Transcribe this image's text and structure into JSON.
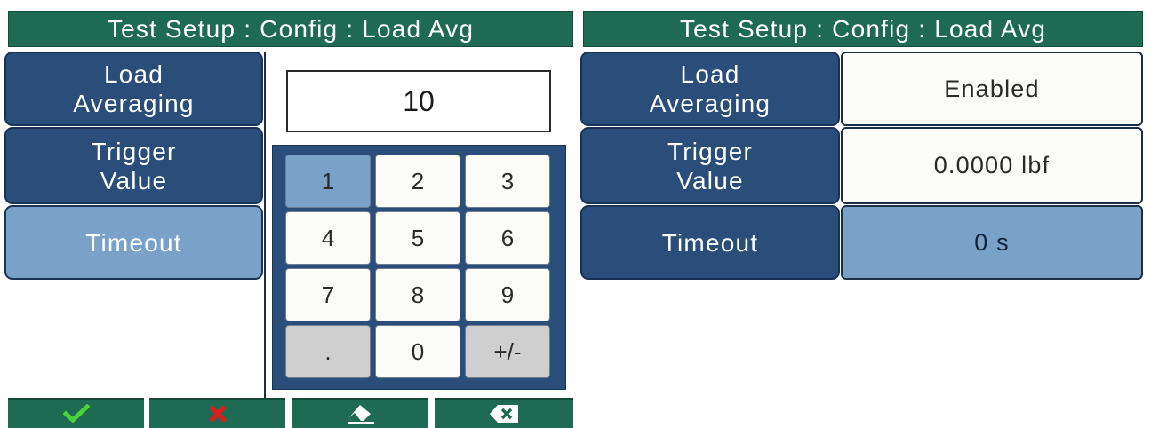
{
  "left_screen": {
    "title": "Test Setup : Config : Load Avg",
    "labels": [
      "Load\nAveraging",
      "Trigger\nValue",
      "Timeout"
    ],
    "entry_value": "10",
    "keypad": [
      [
        "1",
        "2",
        "3"
      ],
      [
        "4",
        "5",
        "6"
      ],
      [
        "7",
        "8",
        "9"
      ],
      [
        ".",
        "0",
        "+/-"
      ]
    ],
    "selected_key": "1",
    "footer": {
      "confirm_icon": "check-icon",
      "cancel_icon": "x-icon",
      "clear_icon": "eraser-icon",
      "backspace_icon": "backspace-icon"
    }
  },
  "right_screen": {
    "title": "Test Setup : Config : Load Avg",
    "rows": [
      {
        "label": "Load\nAveraging",
        "value": "Enabled"
      },
      {
        "label": "Trigger\nValue",
        "value": "0.0000 lbf"
      },
      {
        "label": "Timeout",
        "value": "0 s"
      }
    ],
    "active_row": 2
  },
  "colors": {
    "title_bg": "#1e6a52",
    "label_bg": "#2b4d7a",
    "active_bg": "#7aa1c8",
    "confirm": "#4cd13a",
    "cancel": "#e01b1b"
  }
}
